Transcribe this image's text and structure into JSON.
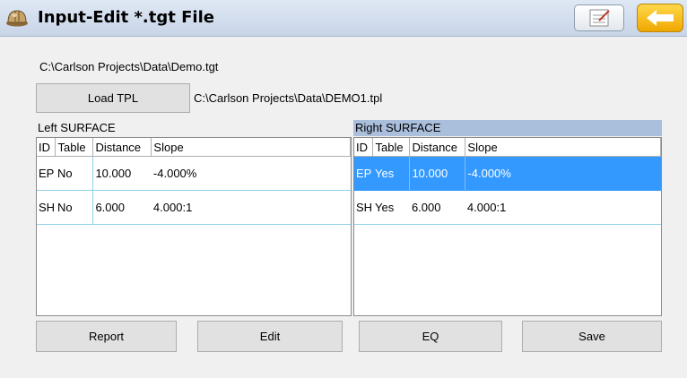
{
  "window": {
    "title": "Input-Edit *.tgt File"
  },
  "icons": {
    "app": "hard-hat-icon",
    "notes": "notepad-icon",
    "back": "back-arrow-icon"
  },
  "file_path": "C:\\Carlson Projects\\Data\\Demo.tgt",
  "load_tpl": {
    "label": "Load TPL",
    "path": "C:\\Carlson Projects\\Data\\DEMO1.tpl"
  },
  "left_surface": {
    "label": "Left SURFACE",
    "columns": [
      "ID",
      "Table",
      "Distance",
      "Slope"
    ],
    "rows": [
      {
        "id": "EP",
        "table": "No",
        "distance": "10.000",
        "slope": "-4.000%"
      },
      {
        "id": "SH",
        "table": "No",
        "distance": "6.000",
        "slope": "4.000:1"
      }
    ]
  },
  "right_surface": {
    "label": "Right SURFACE",
    "columns": [
      "ID",
      "Table",
      "Distance",
      "Slope"
    ],
    "rows": [
      {
        "id": "EP",
        "table": "Yes",
        "distance": "10.000",
        "slope": "-4.000%",
        "selected": true
      },
      {
        "id": "SH",
        "table": "Yes",
        "distance": "6.000",
        "slope": "4.000:1",
        "selected": false
      }
    ]
  },
  "buttons": {
    "report": "Report",
    "edit": "Edit",
    "eq": "EQ",
    "save": "Save"
  },
  "colors": {
    "selection": "#3399ff",
    "right_header": "#aabfdc",
    "back_button": "#f5b800"
  }
}
